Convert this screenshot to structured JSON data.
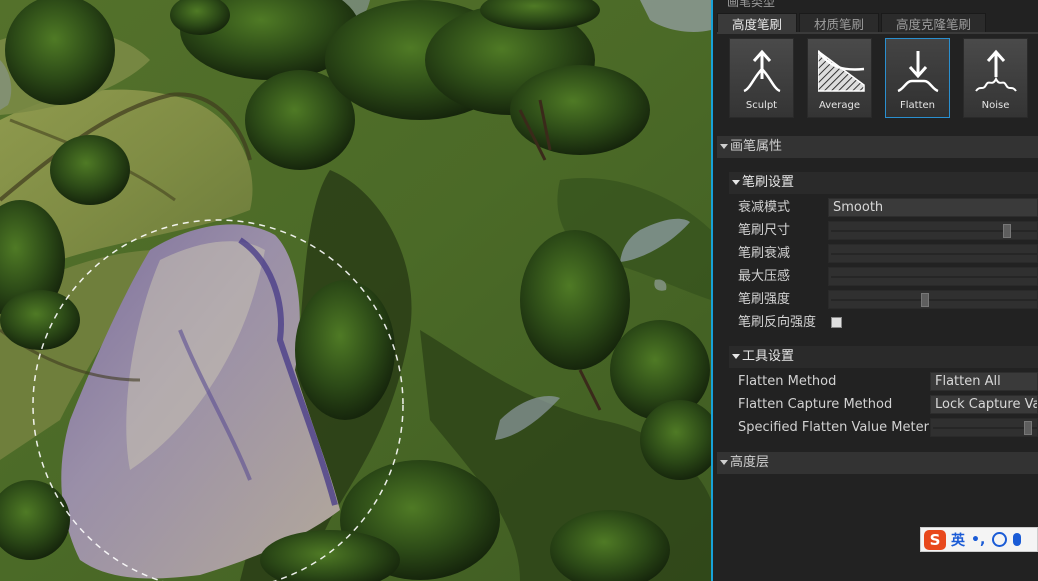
{
  "panel": {
    "brush_type_section": "画笔类型",
    "tabs": [
      {
        "label": "高度笔刷",
        "active": true
      },
      {
        "label": "材质笔刷",
        "active": false
      },
      {
        "label": "高度克隆笔刷",
        "active": false
      }
    ],
    "brushes": [
      {
        "label": "Sculpt",
        "icon": "sculpt-icon",
        "selected": false
      },
      {
        "label": "Average",
        "icon": "average-icon",
        "selected": false
      },
      {
        "label": "Flatten",
        "icon": "flatten-icon",
        "selected": true
      },
      {
        "label": "Noise",
        "icon": "noise-icon",
        "selected": false
      }
    ],
    "brush_props_header": "画笔属性",
    "brush_settings": {
      "header": "笔刷设置",
      "falloff_mode_label": "衰减模式",
      "falloff_mode_value": "Smooth",
      "size_label": "笔刷尺寸",
      "size_value": 0.53,
      "falloff_label": "笔刷衰减",
      "max_pressure_label": "最大压感",
      "strength_label": "笔刷强度",
      "strength_value": 0.28,
      "invert_label": "笔刷反向强度",
      "invert_checked": false
    },
    "tool_settings": {
      "header": "工具设置",
      "flatten_method_label": "Flatten Method",
      "flatten_method_value": "Flatten All",
      "capture_method_label": "Flatten Capture Method",
      "capture_method_value": "Lock Capture Value",
      "specified_value_label": "Specified Flatten Value Meter",
      "specified_value": 0.55
    },
    "height_layers_header": "高度层"
  },
  "ime": {
    "logo": "S",
    "mode": "英",
    "punct": "•,"
  },
  "colors": {
    "accent": "#17a2d8",
    "panel_bg": "#222222",
    "header_bg": "#333333"
  }
}
